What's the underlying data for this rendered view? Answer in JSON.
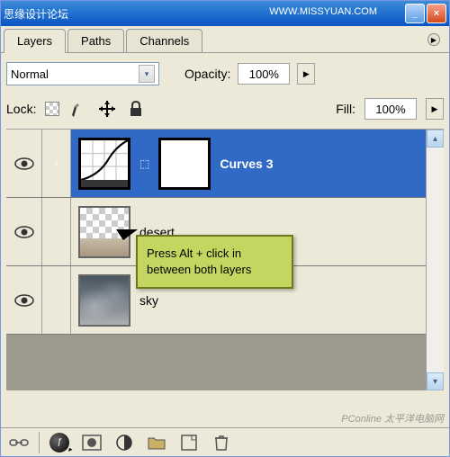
{
  "titlebar": {
    "title": "思缘设计论坛",
    "url": "WWW.MISSYUAN.COM"
  },
  "tabs": {
    "layers": "Layers",
    "paths": "Paths",
    "channels": "Channels"
  },
  "blend": {
    "mode": "Normal",
    "opacity_label": "Opacity:",
    "opacity_value": "100%"
  },
  "lock": {
    "label": "Lock:",
    "fill_label": "Fill:",
    "fill_value": "100%"
  },
  "layers": [
    {
      "name": "Curves 3",
      "type": "adjustment"
    },
    {
      "name": "desert",
      "type": "image"
    },
    {
      "name": "sky",
      "type": "image"
    }
  ],
  "tooltip": {
    "text": "Press Alt + click in between both layers"
  },
  "watermark_bottom": "PConline 太平洋电脑网"
}
